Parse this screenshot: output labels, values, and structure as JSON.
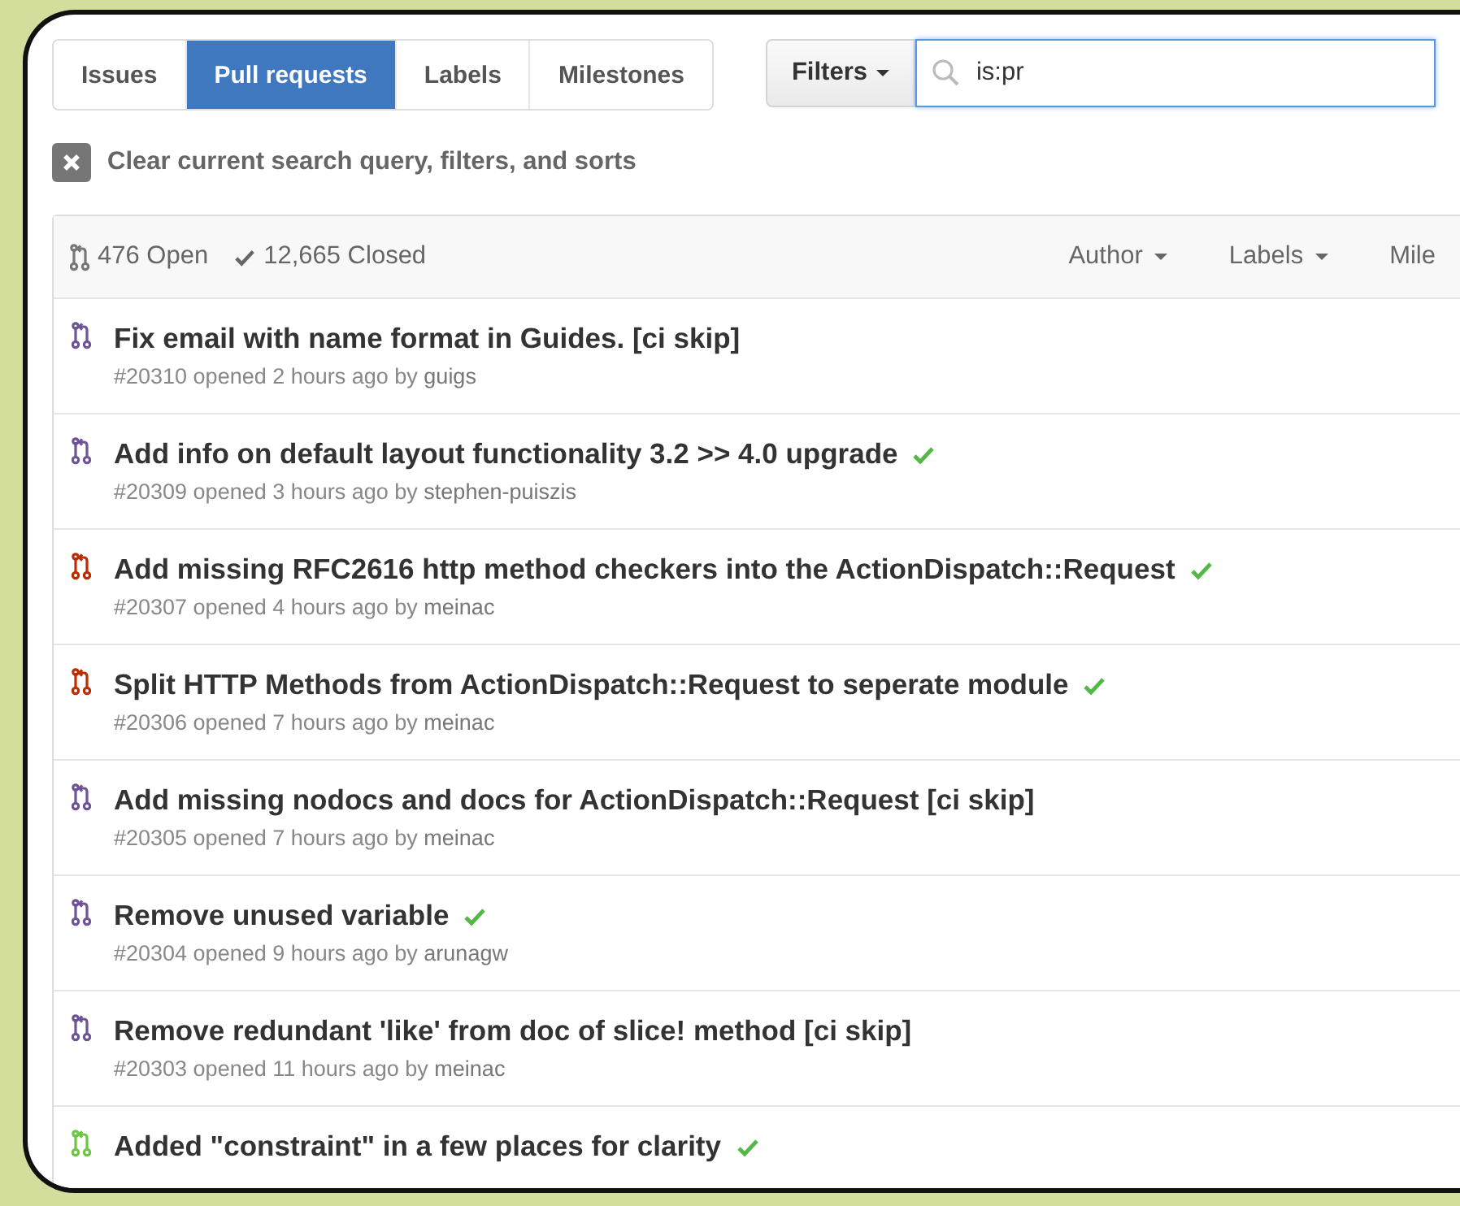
{
  "tabs": [
    {
      "label": "Issues",
      "selected": false
    },
    {
      "label": "Pull requests",
      "selected": true
    },
    {
      "label": "Labels",
      "selected": false
    },
    {
      "label": "Milestones",
      "selected": false
    }
  ],
  "filters_button": "Filters",
  "search": {
    "value": "is:pr"
  },
  "clear_query": "Clear current search query, filters, and sorts",
  "list_header": {
    "open_count": "476 Open",
    "closed_count": "12,665 Closed",
    "filters": [
      "Author",
      "Labels"
    ],
    "cut_filter": "Mile"
  },
  "pull_requests": [
    {
      "color": "#6e5494",
      "title": "Fix email with name format in Guides. [ci skip]",
      "ci_passed": false,
      "number": "#20310",
      "opened": "opened 2 hours ago by",
      "author": "guigs"
    },
    {
      "color": "#6e5494",
      "title": "Add info on default layout functionality 3.2 >> 4.0 upgrade",
      "ci_passed": true,
      "number": "#20309",
      "opened": "opened 3 hours ago by",
      "author": "stephen-puiszis"
    },
    {
      "color": "#bd2c00",
      "title": "Add missing RFC2616 http method checkers into the ActionDispatch::Request",
      "ci_passed": true,
      "number": "#20307",
      "opened": "opened 4 hours ago by",
      "author": "meinac"
    },
    {
      "color": "#bd2c00",
      "title": "Split HTTP Methods from ActionDispatch::Request to seperate module",
      "ci_passed": true,
      "number": "#20306",
      "opened": "opened 7 hours ago by",
      "author": "meinac"
    },
    {
      "color": "#6e5494",
      "title": "Add missing nodocs and docs for ActionDispatch::Request [ci skip]",
      "ci_passed": false,
      "number": "#20305",
      "opened": "opened 7 hours ago by",
      "author": "meinac"
    },
    {
      "color": "#6e5494",
      "title": "Remove unused variable",
      "ci_passed": true,
      "number": "#20304",
      "opened": "opened 9 hours ago by",
      "author": "arunagw"
    },
    {
      "color": "#6e5494",
      "title": "Remove redundant 'like' from doc of slice! method [ci skip]",
      "ci_passed": false,
      "number": "#20303",
      "opened": "opened 11 hours ago by",
      "author": "meinac"
    },
    {
      "color": "#6cc644",
      "title": "Added \"constraint\" in a few places for clarity",
      "ci_passed": true
    }
  ]
}
